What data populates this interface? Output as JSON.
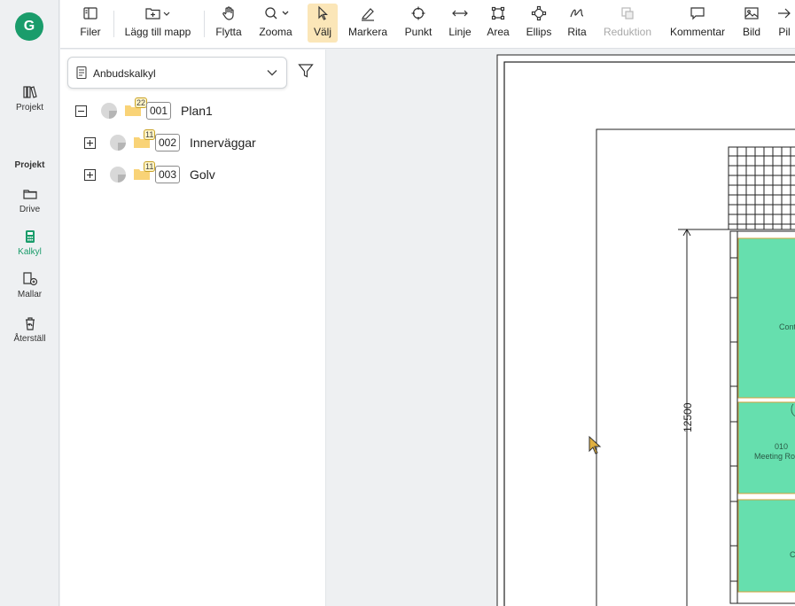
{
  "rail": {
    "logo": "G",
    "items": [
      {
        "label": "Projekt"
      },
      {
        "label": "Drive"
      },
      {
        "label": "Kalkyl"
      },
      {
        "label": "Mallar"
      },
      {
        "label": "Återställ"
      }
    ],
    "section": "Projekt",
    "accent": "#1a9c6b"
  },
  "toolbar": {
    "tools": [
      {
        "label": "Filer"
      },
      {
        "label": "Lägg till mapp"
      },
      {
        "label": "Flytta"
      },
      {
        "label": "Zooma"
      },
      {
        "label": "Välj"
      },
      {
        "label": "Markera"
      },
      {
        "label": "Punkt"
      },
      {
        "label": "Linje"
      },
      {
        "label": "Area"
      },
      {
        "label": "Ellips"
      },
      {
        "label": "Rita"
      },
      {
        "label": "Reduktion"
      },
      {
        "label": "Kommentar"
      },
      {
        "label": "Bild"
      },
      {
        "label": "Pil"
      }
    ]
  },
  "panel": {
    "select_value": "Anbudskalkyl",
    "tree": [
      {
        "count": "22",
        "code": "001",
        "name": "Plan1",
        "expanded": true
      },
      {
        "count": "11",
        "code": "002",
        "name": "Innerväggar",
        "expanded": false
      },
      {
        "count": "11",
        "code": "003",
        "name": "Golv",
        "expanded": false
      }
    ]
  },
  "drawing": {
    "dimension": "12500",
    "room_contr": "Contr",
    "room_010_number": "010",
    "room_010_name": "Meeting Ro",
    "room_bottom_a": "C",
    "room_bottom_b": "C",
    "room_fill": "#66dfae"
  }
}
